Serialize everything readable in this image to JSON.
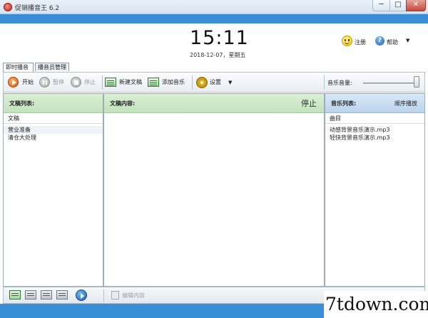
{
  "window": {
    "title": "促销播音王 6.2",
    "min_symbol": "─",
    "max_symbol": "□",
    "close_symbol": "✕"
  },
  "header": {
    "time": "15:11",
    "date": "2018-12-07，星期五",
    "register_label": "注册",
    "help_label": "帮助",
    "help_icon_glyph": "?",
    "help_arrow": "▼"
  },
  "tabs": [
    {
      "label": "即时播音"
    },
    {
      "label": "播音员管理"
    }
  ],
  "toolbar": {
    "play_label": "开始",
    "pause_label": "暂停",
    "stop_label": "停止",
    "new_doc_label": "新建文稿",
    "add_music_label": "添加音乐",
    "settings_label": "设置",
    "settings_arrow": "▼",
    "volume_label": "音乐音量:",
    "volume_level": 0.92
  },
  "panels": {
    "docs": {
      "title": "文稿列表:",
      "column": "文稿",
      "items": [
        "营业准备",
        "清仓大处理"
      ]
    },
    "content": {
      "title": "文稿内容:",
      "status": "停止"
    },
    "music": {
      "title": "音乐列表:",
      "mode": "顺序播放",
      "column": "曲目",
      "items": [
        "动感背景音乐演示.mp3",
        "轻快背景音乐演示.mp3"
      ]
    }
  },
  "bottom": {
    "edit_label": "编辑内容"
  },
  "watermark": "7tdown.com",
  "colors": {
    "accent_blue": "#3a8ed8",
    "panel_green": "#c3e3bd",
    "panel_blue": "#bcd4ee"
  }
}
